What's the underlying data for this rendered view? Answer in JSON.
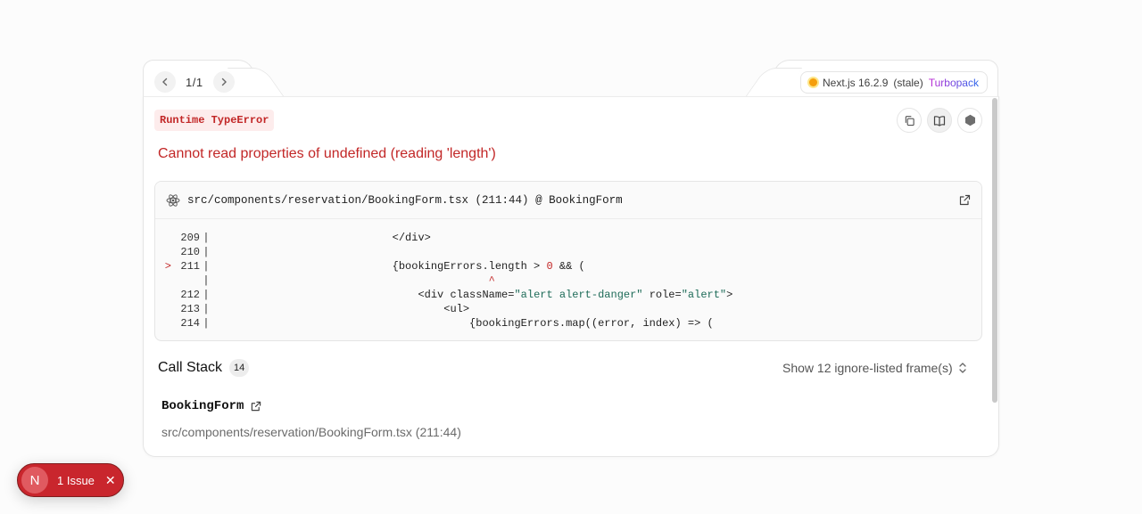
{
  "nav": {
    "pager": "1/1",
    "prev_icon": "chevron-left-icon",
    "next_icon": "chevron-right-icon"
  },
  "version": {
    "name": "Next.js 16.2.9",
    "status": "(stale)",
    "bundler": "Turbopack",
    "dot_color": "#f59e0b"
  },
  "error": {
    "type": "Runtime TypeError",
    "message": "Cannot read properties of undefined (reading 'length')"
  },
  "toolbar": {
    "copy_icon": "copy-icon",
    "docs_icon": "book-icon",
    "nodejs_icon": "hexagon-icon"
  },
  "code_frame": {
    "file": "src/components/reservation/BookingForm.tsx (211:44) @ BookingForm",
    "lines": [
      {
        "marker": "",
        "num": "209",
        "code": "                            </div>"
      },
      {
        "marker": "",
        "num": "210",
        "code": ""
      },
      {
        "marker": ">",
        "num": "211",
        "code": "                            {bookingErrors.length > 0 && ("
      },
      {
        "marker": "",
        "num": "",
        "code": "                                           ^"
      },
      {
        "marker": "",
        "num": "212",
        "code": "                                <div className=\"alert alert-danger\" role=\"alert\">"
      },
      {
        "marker": "",
        "num": "213",
        "code": "                                    <ul>"
      },
      {
        "marker": "",
        "num": "214",
        "code": "                                        {bookingErrors.map((error, index) => ("
      }
    ]
  },
  "callstack": {
    "title": "Call Stack",
    "count": "14",
    "ignore_toggle": "Show 12 ignore-listed frame(s)",
    "frames": [
      {
        "name": "BookingForm",
        "path": "src/components/reservation/BookingForm.tsx (211:44)"
      }
    ]
  },
  "issues": {
    "logo": "N",
    "label": "1 Issue"
  },
  "colors": {
    "error": "#c22727",
    "pill": "#c9262d"
  }
}
